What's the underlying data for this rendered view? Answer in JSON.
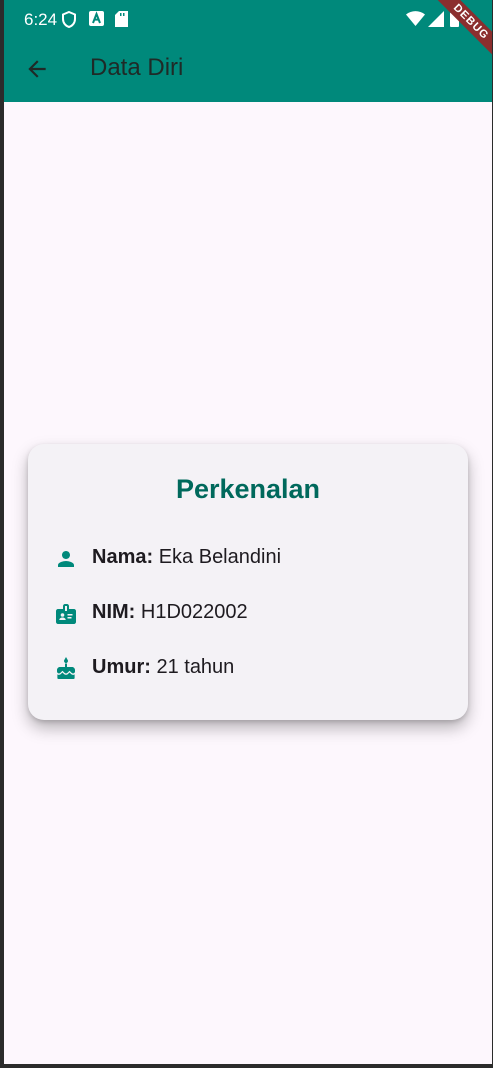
{
  "status_bar": {
    "time": "6:24"
  },
  "app_bar": {
    "title": "Data Diri",
    "back_icon": "arrow-back-icon",
    "color": "#00897b"
  },
  "debug_banner": "DEBUG",
  "card": {
    "title": "Perkenalan",
    "title_color": "#00695c",
    "rows": [
      {
        "icon": "person-icon",
        "label": "Nama:",
        "value": "Eka Belandini"
      },
      {
        "icon": "badge-icon",
        "label": "NIM:",
        "value": "H1D022002"
      },
      {
        "icon": "cake-icon",
        "label": "Umur:",
        "value": "21 tahun"
      }
    ]
  }
}
